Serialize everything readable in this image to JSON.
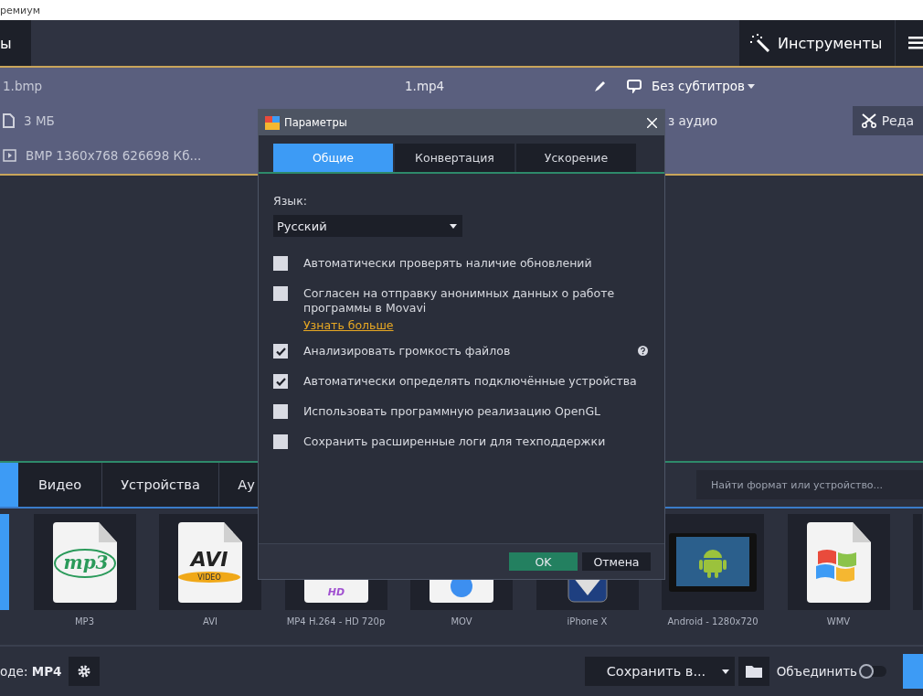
{
  "window": {
    "title": "ремиум"
  },
  "toolbar": {
    "left_tab": "ы",
    "tools_button": "Инструменты"
  },
  "file": {
    "source_name": "1.bmp",
    "output_name": "1.mp4",
    "subtitles": "Без субтитров",
    "size": "3 МБ",
    "audio": "з аудио",
    "edit_button": "Реда",
    "video_info": "BMP 1360x768 626698 Кб..."
  },
  "format_tabs": [
    {
      "label": "Видео",
      "selected": false
    },
    {
      "label": "Устройства",
      "selected": false
    },
    {
      "label": "Ау",
      "selected": false
    }
  ],
  "search": {
    "placeholder": "Найти формат или устройство..."
  },
  "formats": [
    {
      "label": "MP3",
      "kind": "mp3",
      "logo": "mp3"
    },
    {
      "label": "AVI",
      "kind": "avi",
      "logo": "AVI",
      "badge": "VIDEO"
    },
    {
      "label": "MP4 H.264 - HD 720p",
      "kind": "mp4",
      "logo": "HD"
    },
    {
      "label": "MOV",
      "kind": "mov"
    },
    {
      "label": "iPhone X",
      "kind": "iphone"
    },
    {
      "label": "Android - 1280x720",
      "kind": "android"
    },
    {
      "label": "WMV",
      "kind": "wmv"
    }
  ],
  "bottom": {
    "format": "оде: **MP4**",
    "save_to": "Сохранить в...",
    "merge": {
      "label": "Объединить",
      "on": false
    }
  },
  "dialog": {
    "title": "Параметры",
    "tabs": [
      {
        "label": "Общие",
        "selected": true
      },
      {
        "label": "Конвертация",
        "selected": false
      },
      {
        "label": "Ускорение",
        "selected": false
      }
    ],
    "language_label": "Язык:",
    "language": "Русский",
    "options": [
      {
        "label": "Автоматически проверять наличие обновлений",
        "checked": false
      },
      {
        "label": "Согласен на отправку анонимных данных о работе программы в Movavi",
        "checked": false,
        "link": "Узнать больше"
      },
      {
        "label": "Анализировать громкость файлов",
        "checked": true,
        "help": true
      },
      {
        "label": "Автоматически определять подключённые устройства",
        "checked": true
      },
      {
        "label": "Использовать программную реализацию OpenGL",
        "checked": false
      },
      {
        "label": "Сохранить расширенные логи для техподдержки",
        "checked": false
      }
    ],
    "buttons": [
      "OK",
      "Отмена"
    ]
  }
}
